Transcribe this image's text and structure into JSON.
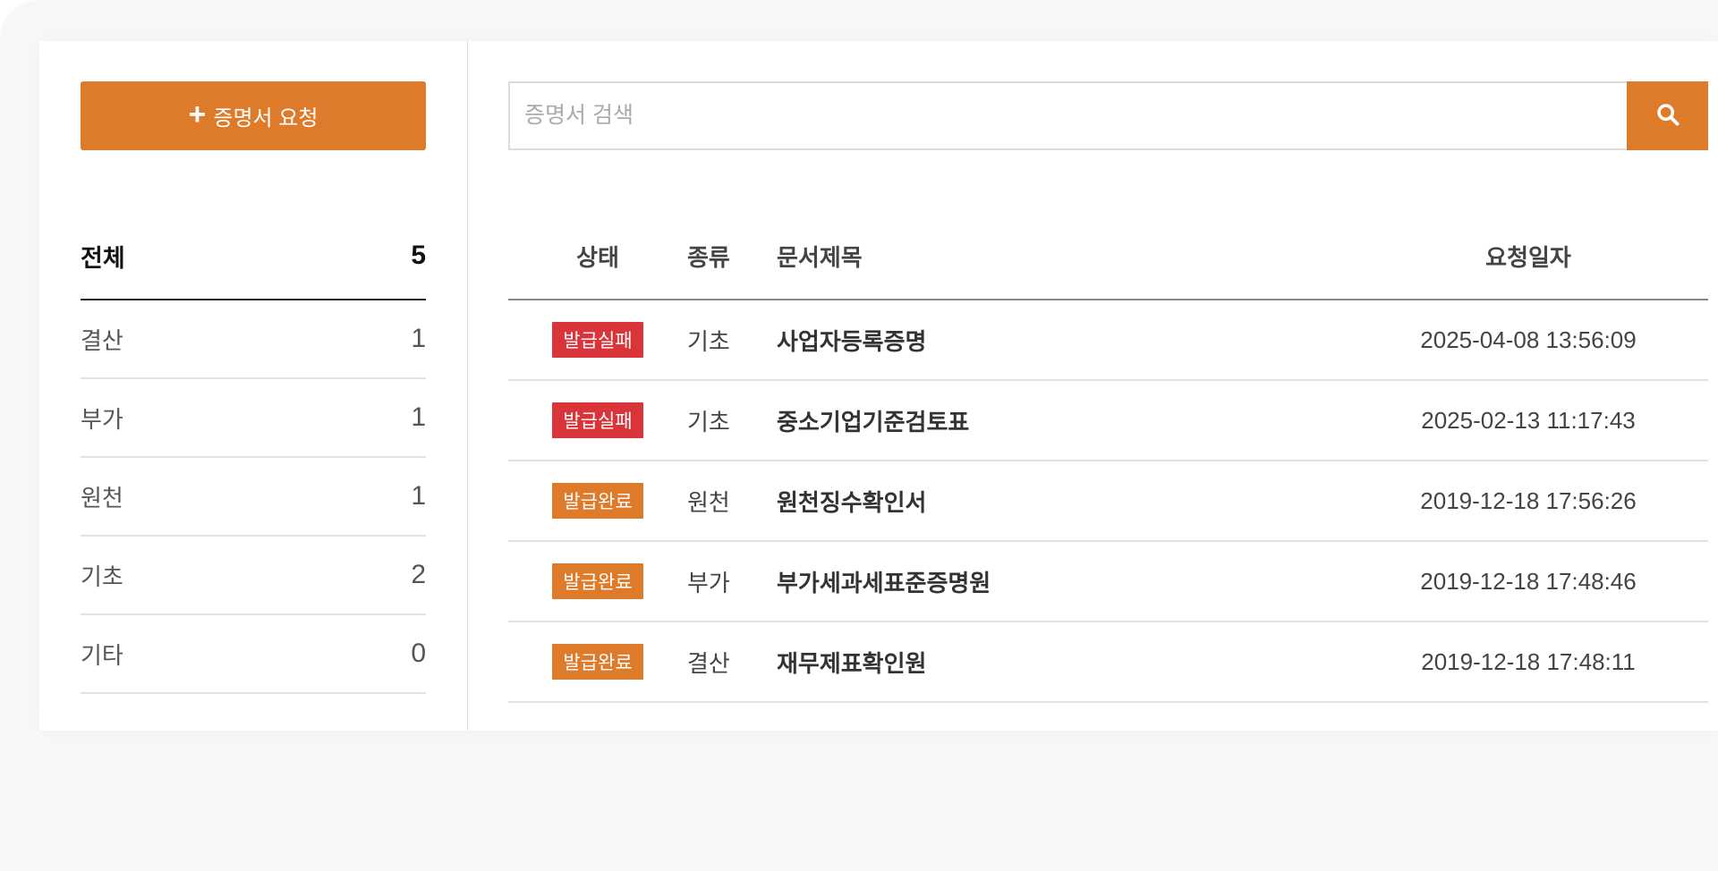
{
  "colors": {
    "accent": "#de7b2b",
    "fail": "#d9343a",
    "complete": "#de7b2b"
  },
  "sidebar": {
    "request_button": {
      "icon": "plus-icon",
      "label": "증명서 요청"
    },
    "categories": [
      {
        "label": "전체",
        "count": "5"
      },
      {
        "label": "결산",
        "count": "1"
      },
      {
        "label": "부가",
        "count": "1"
      },
      {
        "label": "원천",
        "count": "1"
      },
      {
        "label": "기초",
        "count": "2"
      },
      {
        "label": "기타",
        "count": "0"
      }
    ]
  },
  "search": {
    "placeholder": "증명서 검색",
    "value": "",
    "button_icon": "search-icon"
  },
  "table": {
    "headers": {
      "status": "상태",
      "type": "종류",
      "title": "문서제목",
      "date": "요청일자"
    },
    "rows": [
      {
        "status": "발급실패",
        "status_kind": "fail",
        "type": "기초",
        "title": "사업자등록증명",
        "date": "2025-04-08 13:56:09"
      },
      {
        "status": "발급실패",
        "status_kind": "fail",
        "type": "기초",
        "title": "중소기업기준검토표",
        "date": "2025-02-13 11:17:43"
      },
      {
        "status": "발급완료",
        "status_kind": "complete",
        "type": "원천",
        "title": "원천징수확인서",
        "date": "2019-12-18 17:56:26"
      },
      {
        "status": "발급완료",
        "status_kind": "complete",
        "type": "부가",
        "title": "부가세과세표준증명원",
        "date": "2019-12-18 17:48:46"
      },
      {
        "status": "발급완료",
        "status_kind": "complete",
        "type": "결산",
        "title": "재무제표확인원",
        "date": "2019-12-18 17:48:11"
      }
    ]
  }
}
